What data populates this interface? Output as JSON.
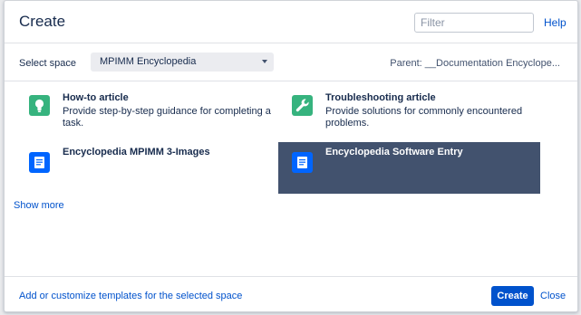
{
  "dialog": {
    "title": "Create",
    "help_label": "Help",
    "filter": {
      "placeholder": "Filter",
      "value": ""
    }
  },
  "space": {
    "label": "Select space",
    "selected": "MPIMM Encyclopedia",
    "parent_text": "Parent: __Documentation Encyclope..."
  },
  "templates": [
    {
      "name": "How-to article",
      "description": "Provide step-by-step guidance for completing a task.",
      "icon": "lightbulb-icon",
      "color": "#36b37e"
    },
    {
      "name": "Troubleshooting article",
      "description": "Provide solutions for commonly encountered problems.",
      "icon": "wrench-icon",
      "color": "#36b37e"
    },
    {
      "name": "Encyclopedia MPIMM 3-Images",
      "description": "",
      "icon": "document-icon",
      "color": "#0065ff"
    },
    {
      "name": "Encyclopedia Software Entry",
      "description": "",
      "icon": "document-icon",
      "color": "#0065ff",
      "selected": true
    }
  ],
  "show_more_label": "Show more",
  "footer": {
    "customize_link": "Add or customize templates for the selected space",
    "create_label": "Create",
    "close_label": "Close"
  },
  "colors": {
    "accent": "#0052cc",
    "selected_bg": "#42526e",
    "green_icon": "#36b37e",
    "blue_icon": "#0065ff"
  }
}
